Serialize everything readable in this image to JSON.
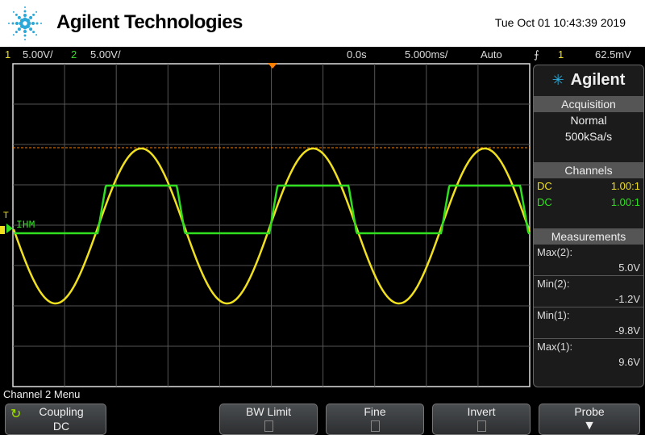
{
  "header": {
    "brand": "Agilent Technologies",
    "datetime": "Tue Oct 01 10:43:39 2019"
  },
  "status": {
    "ch1_num": "1",
    "ch1_scale": "5.00V/",
    "ch2_num": "2",
    "ch2_scale": "5.00V/",
    "delay": "0.0s",
    "timebase": "5.000ms/",
    "mode": "Auto",
    "trigger_icon": "rising-edge-icon",
    "trigger_source": "1",
    "trigger_level": "62.5mV"
  },
  "plot": {
    "ch2_label": "IHM",
    "ch1_color": "#f0e020",
    "ch2_color": "#30e020",
    "trigger_color": "#ff8000"
  },
  "panel": {
    "brand": "Agilent",
    "acquisition_title": "Acquisition",
    "acq_mode": "Normal",
    "sample_rate": "500kSa/s",
    "channels_title": "Channels",
    "channels": [
      {
        "coupling": "DC",
        "probe": "1.00:1"
      },
      {
        "coupling": "DC",
        "probe": "1.00:1"
      }
    ],
    "measurements_title": "Measurements",
    "measurements": [
      {
        "label": "Max(2):",
        "value": "5.0V"
      },
      {
        "label": "Min(2):",
        "value": "-1.2V"
      },
      {
        "label": "Min(1):",
        "value": "-9.8V"
      },
      {
        "label": "Max(1):",
        "value": "9.6V"
      }
    ]
  },
  "menu": {
    "title": "Channel 2 Menu",
    "coupling_label": "Coupling",
    "coupling_value": "DC",
    "bw_limit": "BW Limit",
    "fine": "Fine",
    "invert": "Invert",
    "probe": "Probe"
  }
}
